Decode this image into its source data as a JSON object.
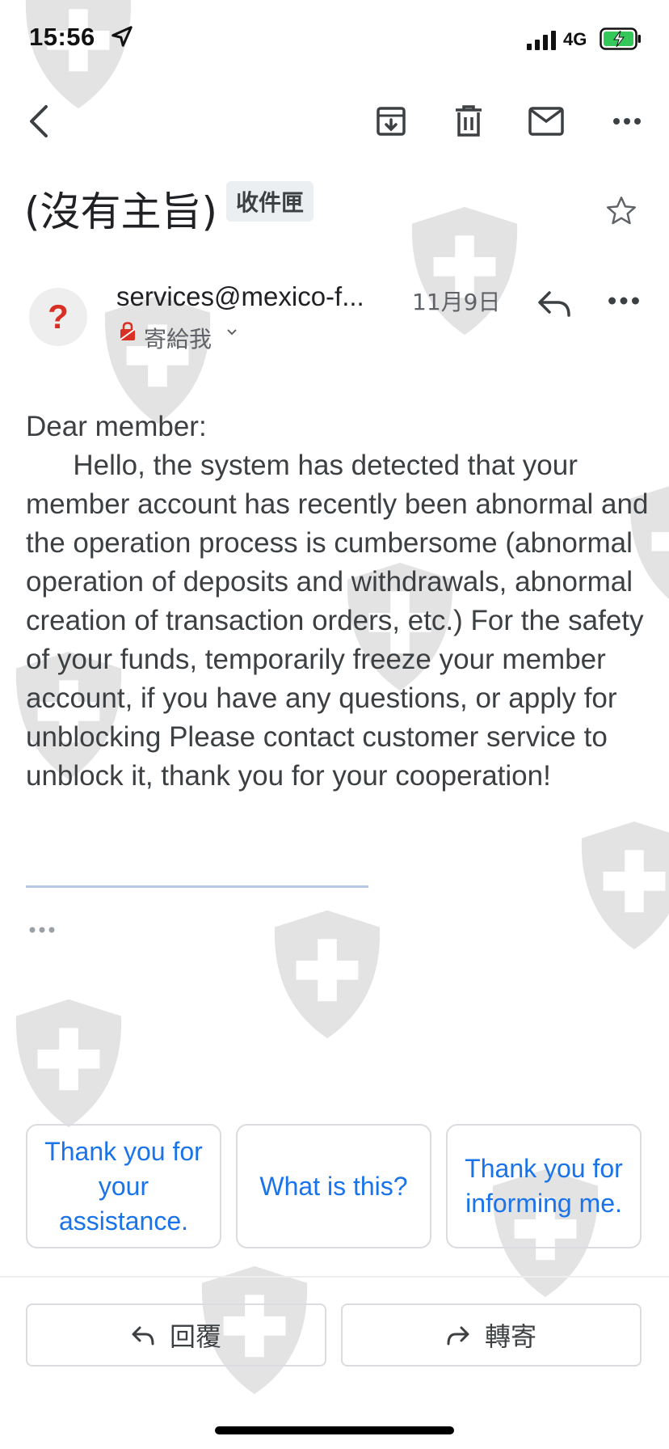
{
  "status_bar": {
    "time": "15:56",
    "network": "4G"
  },
  "toolbar": {
    "back_icon": "chevron-left-icon",
    "archive_icon": "archive-icon",
    "delete_icon": "trash-icon",
    "mark_unread_icon": "mail-icon",
    "more_icon": "more-horizontal-icon"
  },
  "email": {
    "subject": "(沒有主旨)",
    "label": "收件匣",
    "sender": "services@mexico-f...",
    "date": "11月9日",
    "recipient": "寄給我",
    "avatar_glyph": "?",
    "body": "Dear member:\n      Hello, the system has detected that your member account has recently been abnormal and the operation process is cumbersome (abnormal operation of deposits and withdrawals, abnormal creation of transaction orders, etc.) For the safety of your funds, temporarily freeze your member account, if you have any questions, or apply for unblocking Please contact customer service to unblock it, thank you for your cooperation!"
  },
  "smart_replies": [
    {
      "text": "Thank you for your assistance."
    },
    {
      "text": "What is this?"
    },
    {
      "text": "Thank you for informing me."
    }
  ],
  "actions": {
    "reply_label": "回覆",
    "forward_label": "轉寄"
  },
  "colors": {
    "accent_blue": "#1a73e8",
    "avatar_question": "#d93025",
    "battery_green": "#34c759"
  }
}
